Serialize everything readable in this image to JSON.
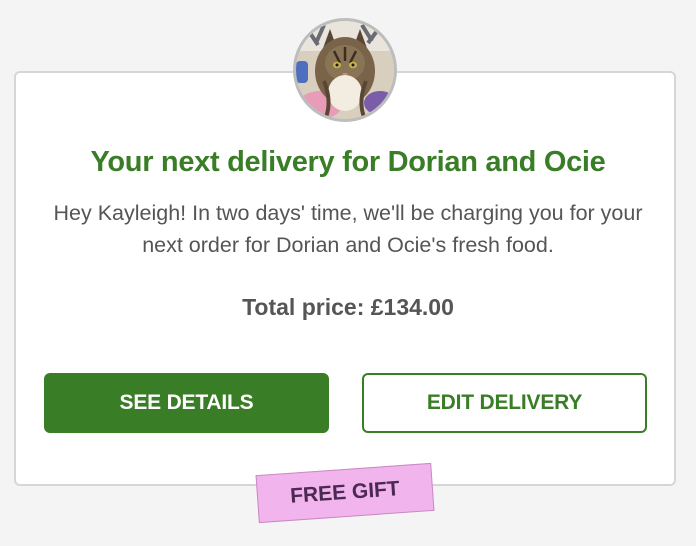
{
  "card": {
    "title": "Your next delivery for Dorian and Ocie",
    "message": "Hey Kayleigh! In two days' time, we'll be charging you for your next order for Dorian and Ocie's fresh food.",
    "total_label": "Total price: £134.00"
  },
  "buttons": {
    "see_details": "SEE DETAILS",
    "edit_delivery": "EDIT DELIVERY"
  },
  "badge": {
    "label": "FREE GIFT"
  },
  "colors": {
    "brand_green": "#3a7d27",
    "gift_pink": "#f1b4ec",
    "text_gray": "#555555"
  },
  "avatar": {
    "subject": "cat-photo"
  }
}
